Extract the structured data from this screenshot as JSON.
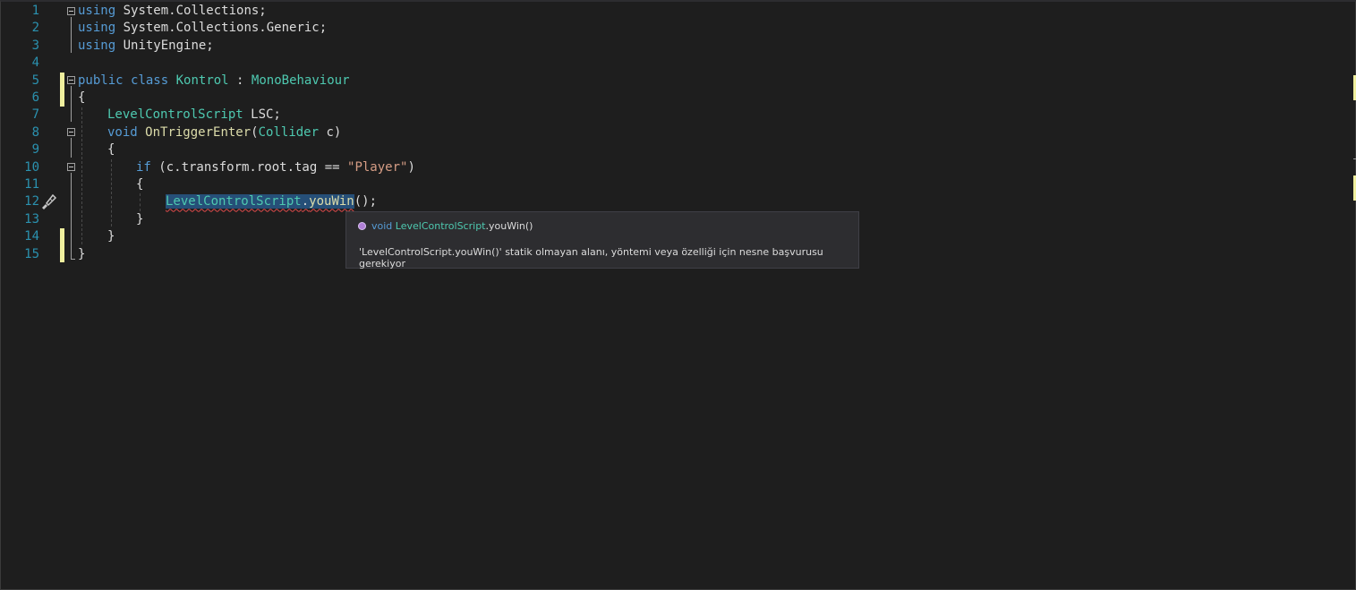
{
  "editor": {
    "line_numbers": [
      "1",
      "2",
      "3",
      "4",
      "5",
      "6",
      "7",
      "8",
      "9",
      "10",
      "11",
      "12",
      "13",
      "14",
      "15"
    ],
    "code": {
      "l1_kw": "using",
      "l1_rest": " System.Collections;",
      "l2_kw": "using",
      "l2_rest": " System.Collections.Generic;",
      "l3_kw": "using",
      "l3_rest": " UnityEngine;",
      "l5_kw1": "public",
      "l5_kw2": "class",
      "l5_cls": "Kontrol",
      "l5_colon": " : ",
      "l5_base": "MonoBehaviour",
      "l6": "{",
      "l7_type": "LevelControlScript",
      "l7_var": " LSC;",
      "l8_kw": "void",
      "l8_fn": "OnTriggerEnter",
      "l8_open": "(",
      "l8_type": "Collider",
      "l8_rest": " c)",
      "l9": "{",
      "l10_kw": "if",
      "l10_mid": " (c.transform.root.tag == ",
      "l10_str": "\"Player\"",
      "l10_end": ")",
      "l11": "{",
      "l12_type": "LevelControlScript",
      "l12_dot": ".",
      "l12_fn": "youWin",
      "l12_end": "();",
      "l13": "}",
      "l14": "}",
      "l15": "}"
    }
  },
  "tooltip": {
    "icon": "method-icon",
    "sig_kw": "void",
    "sig_type": "LevelControlScript",
    "sig_rest": ".youWin()",
    "message": "'LevelControlScript.youWin()' statik olmayan alanı, yöntemi veya özelliği için nesne başvurusu gerekiyor"
  },
  "colors": {
    "background": "#1e1e1e",
    "keyword": "#569cd6",
    "type": "#4ec9b0",
    "method": "#dcdcaa",
    "string": "#d69d85",
    "line_number": "#2b91af",
    "change_marker": "#efef9e",
    "error_squiggle": "#e24a4a"
  }
}
